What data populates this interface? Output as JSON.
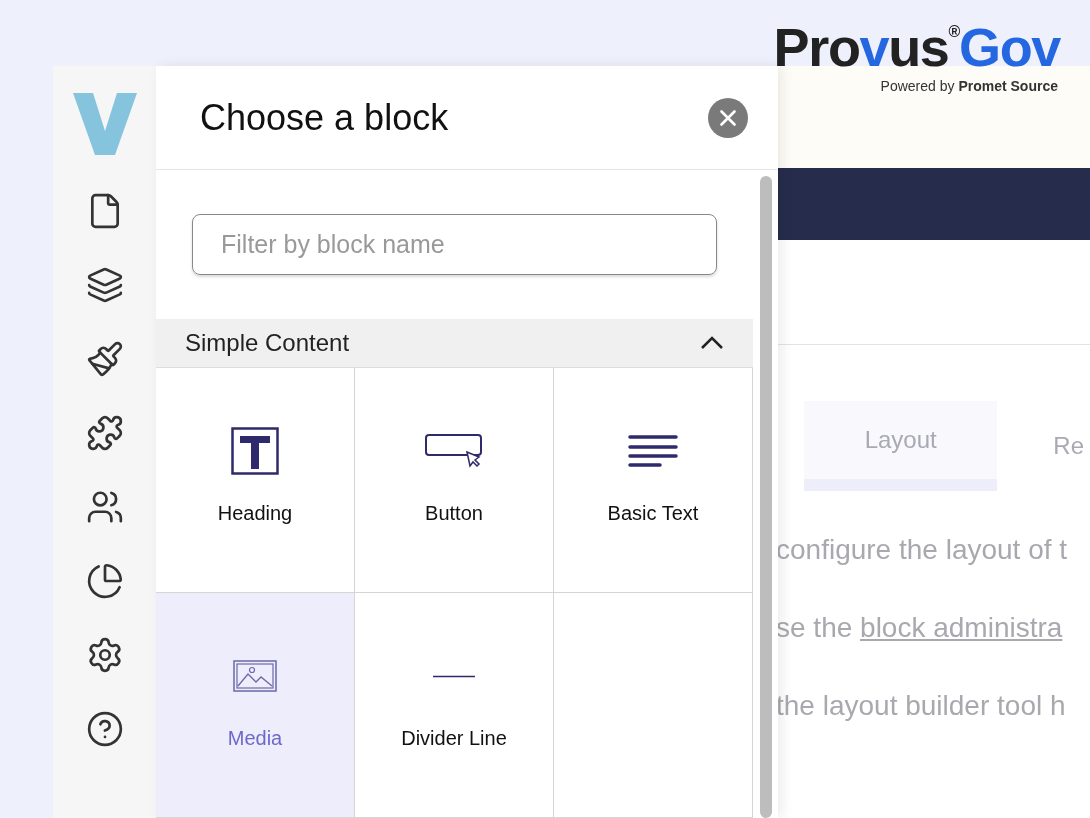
{
  "logo": {
    "parts": [
      {
        "text": "Pro",
        "accent": false
      },
      {
        "text": "v",
        "accent": true
      },
      {
        "text": "us",
        "accent": false
      },
      {
        "text": "®",
        "accent": false
      },
      {
        "text": "Gov",
        "accent": true
      }
    ],
    "tagline": "Powered by **Promet Source**"
  },
  "sidebar": {
    "items": [
      {
        "kind": "page"
      },
      {
        "kind": "layers"
      },
      {
        "kind": "brush"
      },
      {
        "kind": "puzzle"
      },
      {
        "kind": "users"
      },
      {
        "kind": "chart"
      },
      {
        "kind": "settings"
      },
      {
        "kind": "help"
      }
    ]
  },
  "panel": {
    "title": "Choose a block",
    "search": {
      "placeholder": "Filter by block name"
    },
    "section": {
      "title": "Simple Content",
      "expanded": true
    },
    "blocks": [
      {
        "kind": "heading",
        "label": "Heading",
        "selected": false
      },
      {
        "kind": "button",
        "label": "Button",
        "selected": false
      },
      {
        "kind": "text",
        "label": "Basic Text",
        "selected": false
      },
      {
        "kind": "media",
        "label": "Media",
        "selected": true
      },
      {
        "kind": "divider",
        "label": "Divider Line",
        "selected": false
      }
    ]
  },
  "background_page": {
    "tabs": [
      {
        "label": "Layout",
        "selected": true
      },
      {
        "label": "Re",
        "selected": false
      }
    ],
    "lines": [
      {
        "text": "configure the layout of t"
      },
      {
        "text": "se the ",
        "link": "block administra"
      },
      {
        "text": "the layout builder tool h"
      }
    ]
  }
}
